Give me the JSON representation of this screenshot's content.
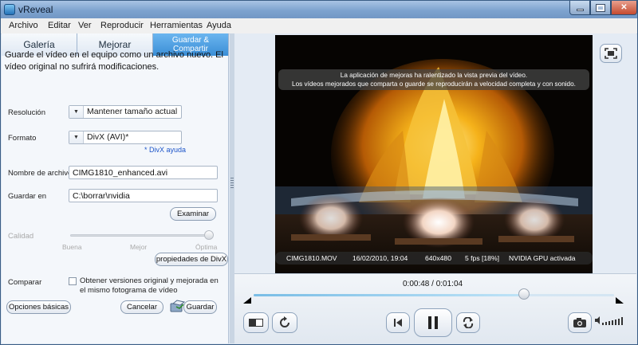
{
  "window": {
    "title": "vReveal"
  },
  "menu": [
    "Archivo",
    "Editar",
    "Ver",
    "Reproducir",
    "Herramientas",
    "Ayuda"
  ],
  "tabs": [
    {
      "label": "Galería",
      "active": false
    },
    {
      "label": "Mejorar",
      "active": false
    },
    {
      "label": "Guardar & Compartir",
      "active": true
    }
  ],
  "save_panel": {
    "intro": "Guarde el vídeo en el equipo como un archivo nuevo. El vídeo original no sufrirá modificaciones.",
    "resolution": {
      "label": "Resolución",
      "value": "Mantener tamaño actual"
    },
    "format": {
      "label": "Formato",
      "value": "DivX (AVI)*",
      "help_link": "* DivX ayuda"
    },
    "filename": {
      "label": "Nombre de archivo",
      "value": "CIMG1810_enhanced.avi"
    },
    "save_in": {
      "label": "Guardar en",
      "value": "C:\\borrar\\nvidia",
      "browse_label": "Examinar"
    },
    "quality": {
      "label": "Calidad",
      "ticks": [
        "Buena",
        "Mejor",
        "Óptima"
      ],
      "level": 1.0,
      "enabled": false
    },
    "divx_props_label": "propiedades de DivX",
    "compare": {
      "label": "Comparar",
      "checkbox_text": "Obtener versiones original y mejorada en el mismo fotograma de vídeo",
      "checked": false
    },
    "buttons": {
      "basic_options": "Opciones básicas",
      "cancel": "Cancelar",
      "save": "Guardar"
    }
  },
  "player": {
    "banner_line1": "La aplicación de mejoras ha ralentizado la vista previa del vídeo.",
    "banner_line2": "Los vídeos mejorados que comparta o guarde se reproducirán a velocidad completa y con sonido.",
    "info": {
      "file": "CIMG1810.MOV",
      "date": "16/02/2010, 19:04",
      "resolution": "640x480",
      "fps": "5 fps [18%]",
      "gpu": "NVIDIA GPU activada"
    },
    "time": "0:00:48 / 0:01:04",
    "progress": 0.75
  },
  "colors": {
    "accent_tab": "#3a8ed6",
    "link": "#1d55c9"
  },
  "icons": [
    "fullscreen-icon",
    "compare-view-icon",
    "rotate-icon",
    "previous-frame-icon",
    "pause-icon",
    "loop-icon",
    "snapshot-camera-icon",
    "volume-icon",
    "save-icon"
  ]
}
